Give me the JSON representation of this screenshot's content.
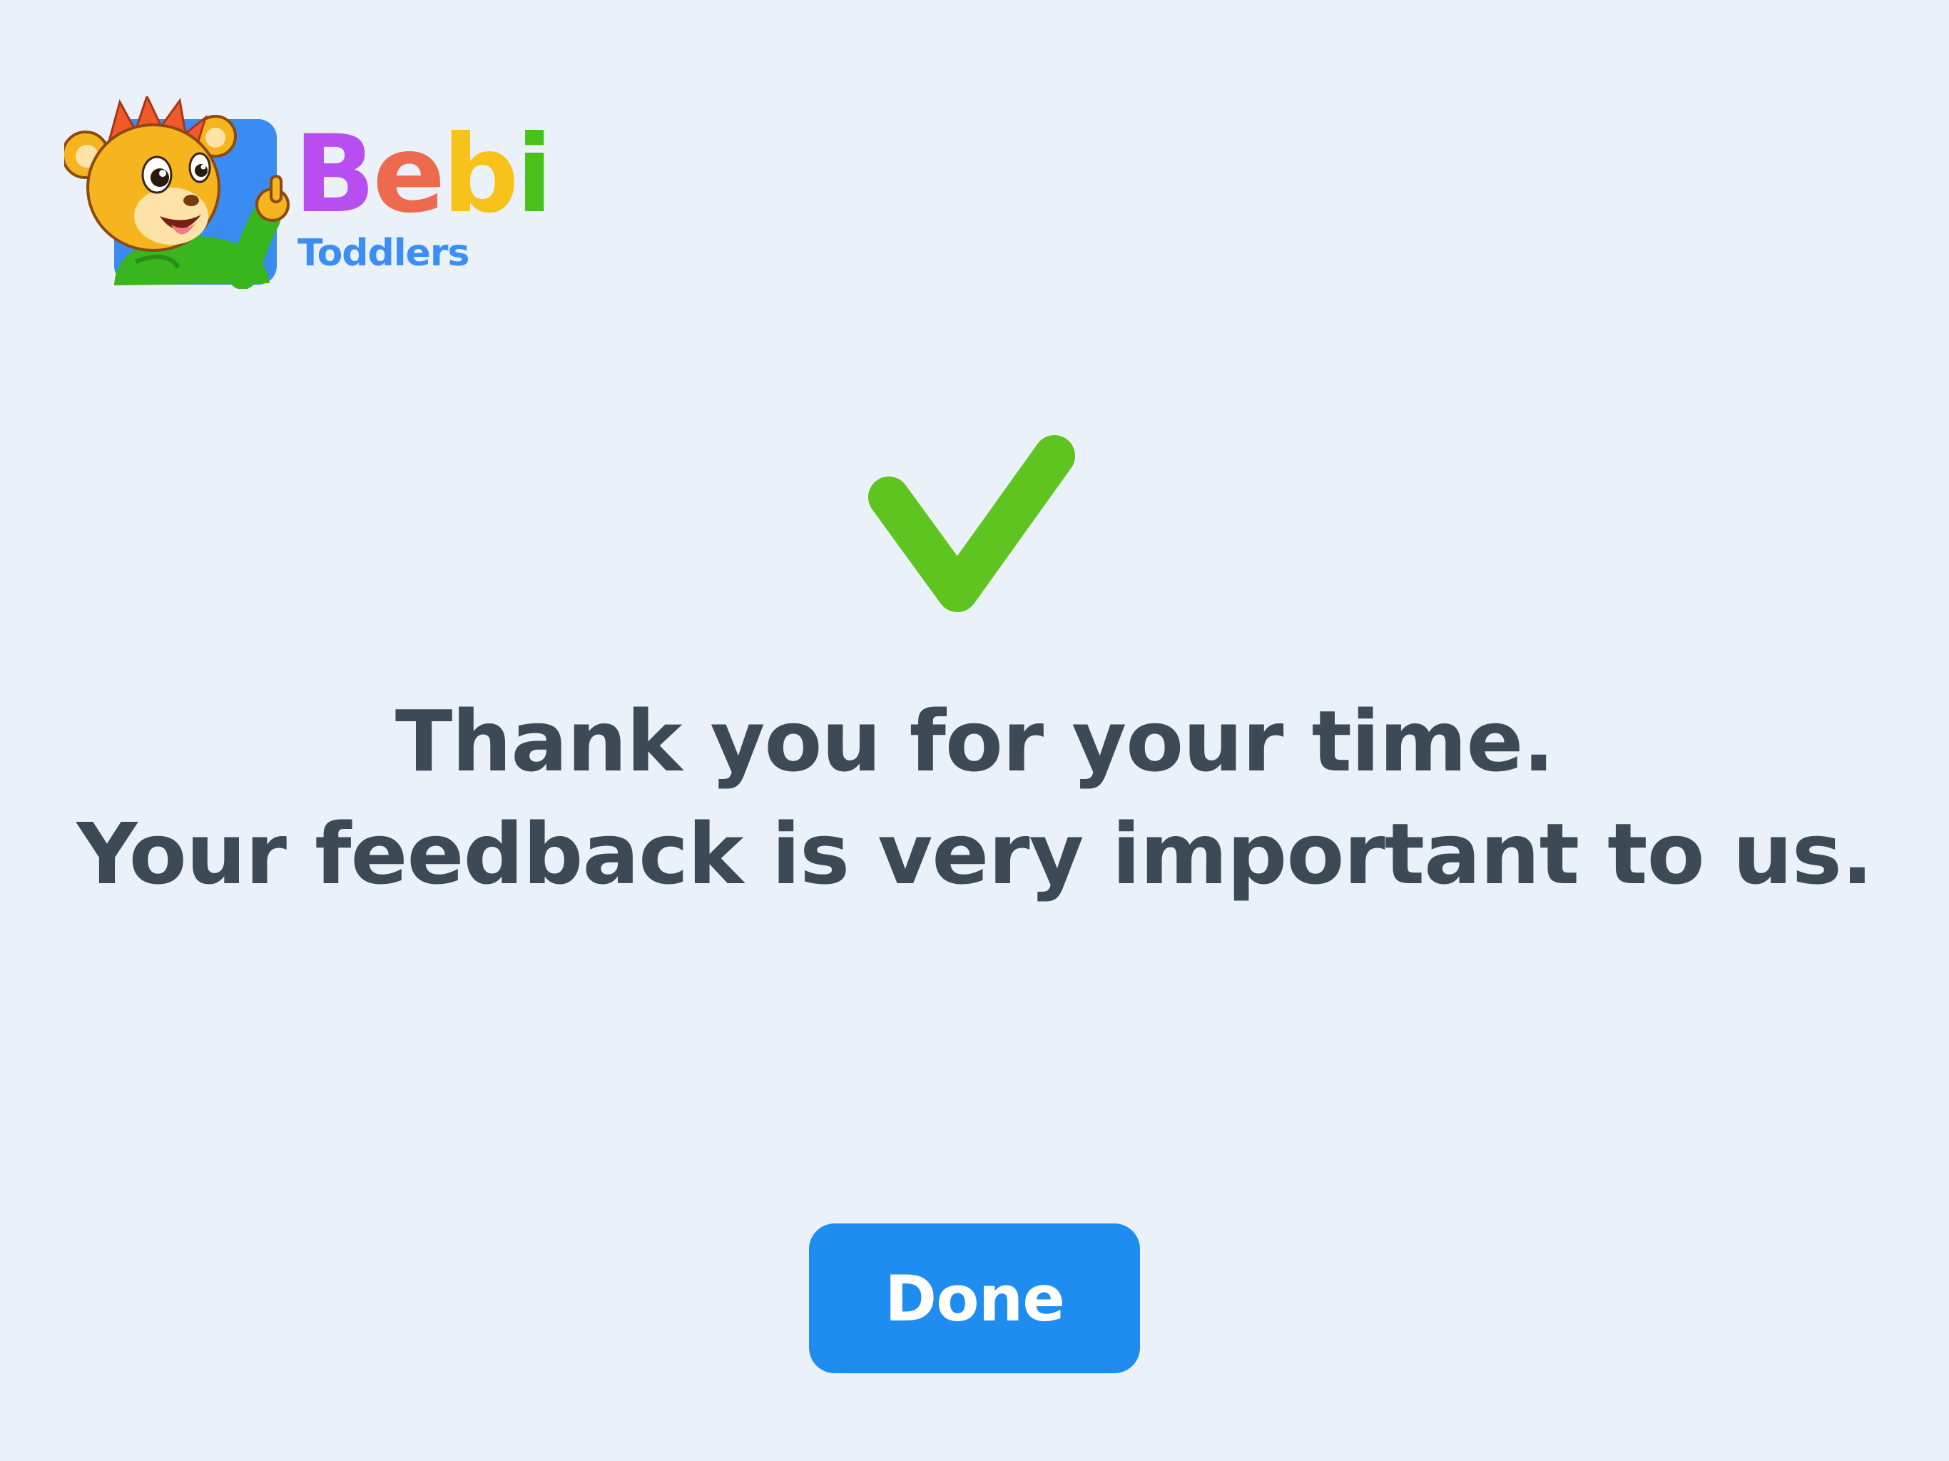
{
  "logo": {
    "mascot_icon": "lion-mascot-icon",
    "brand_letters": [
      {
        "char": "B",
        "color": "#b84ef0"
      },
      {
        "char": "e",
        "color": "#ee6a4f"
      },
      {
        "char": "b",
        "color": "#f7c21a"
      },
      {
        "char": "i",
        "color": "#4bc21b"
      }
    ],
    "subtitle": "Toddlers",
    "subtitle_color": "#3c8ef5"
  },
  "status": {
    "icon": "checkmark-icon",
    "color": "#5ec41f"
  },
  "message": {
    "line1": "Thank you for your time.",
    "line2": "Your feedback is very important to us.",
    "color": "#3d4954"
  },
  "done_button": {
    "label": "Done",
    "color": "#1f8cf0"
  },
  "colors": {
    "background": "#eaf1f8"
  }
}
